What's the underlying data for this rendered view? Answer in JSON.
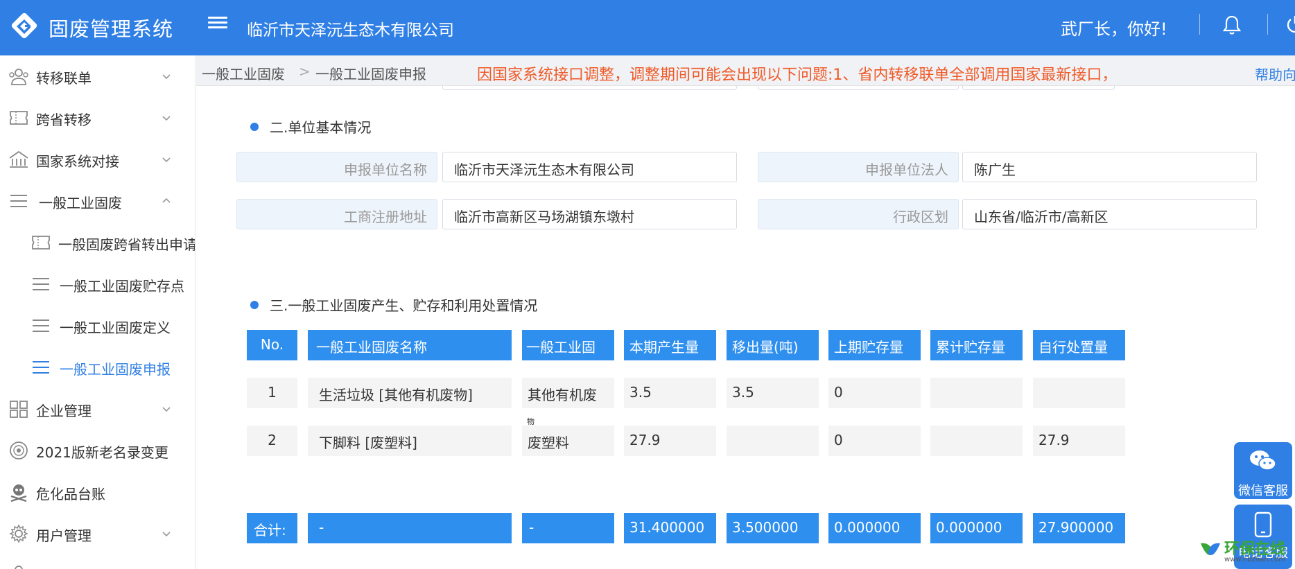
{
  "header": {
    "app_title": "固废管理系统",
    "company": "临沂市天泽沅生态木有限公司",
    "greeting": "武厂长，你好!"
  },
  "colors": {
    "primary": "#2f7fe4",
    "table_header": "#2f8fef",
    "notice": "#f05a28"
  },
  "sidebar": {
    "items": [
      {
        "label": "转移联单",
        "icon": "users-group-icon"
      },
      {
        "label": "跨省转移",
        "icon": "ticket-icon"
      },
      {
        "label": "国家系统对接",
        "icon": "building-icon"
      },
      {
        "label": "一般工业固废",
        "icon": "list-icon"
      },
      {
        "label": "一般固废跨省转出申请",
        "icon": "ticket-icon"
      },
      {
        "label": "一般工业固废贮存点",
        "icon": "list-icon"
      },
      {
        "label": "一般工业固废定义",
        "icon": "list-icon"
      },
      {
        "label": "一般工业固废申报",
        "icon": "list-icon"
      },
      {
        "label": "企业管理",
        "icon": "grid-icon"
      },
      {
        "label": "2021版新老名录变更",
        "icon": "seal-icon"
      },
      {
        "label": "危化品台账",
        "icon": "skull-icon"
      },
      {
        "label": "用户管理",
        "icon": "gear-icon"
      }
    ]
  },
  "breadcrumb": {
    "first": "一般工业固废",
    "second": "一般工业固废申报"
  },
  "notice": "因国家系统接口调整，调整期间可能会出现以下问题:1、省内转移联单全部调用国家最新接口，",
  "help_link": "帮助向导",
  "section2": {
    "title": "二.单位基本情况",
    "fields": [
      {
        "label": "申报单位名称",
        "value": "临沂市天泽沅生态木有限公司"
      },
      {
        "label": "申报单位法人",
        "value": "陈广生"
      },
      {
        "label": "工商注册地址",
        "value": "临沂市高新区马场湖镇东墩村"
      },
      {
        "label": "行政区划",
        "value": "山东省/临沂市/高新区"
      }
    ]
  },
  "section3": {
    "title": "三.一般工业固废产生、贮存和利用处置情况",
    "headers": [
      "No.",
      "一般工业固废名称",
      "一般工业固",
      "本期产生量",
      "移出量(吨)",
      "上期贮存量",
      "累计贮存量",
      "自行处置量"
    ],
    "rows": [
      [
        "1",
        "生活垃圾 [其他有机废物]",
        "其他有机废",
        "3.5",
        "3.5",
        "0",
        "",
        ""
      ],
      [
        "2",
        "下脚料 [废塑料]",
        "废塑料",
        "27.9",
        "",
        "0",
        "",
        "27.9"
      ]
    ],
    "row2_overflow": "物",
    "totals": [
      "合计:",
      "-",
      "-",
      "31.400000",
      "3.500000",
      "0.000000",
      "0.000000",
      "27.900000"
    ]
  },
  "float_buttons": {
    "wechat": "微信客服",
    "phone": "电话客服"
  },
  "watermark": {
    "title": "环保在线",
    "sub": "www.hbzhan.com"
  }
}
